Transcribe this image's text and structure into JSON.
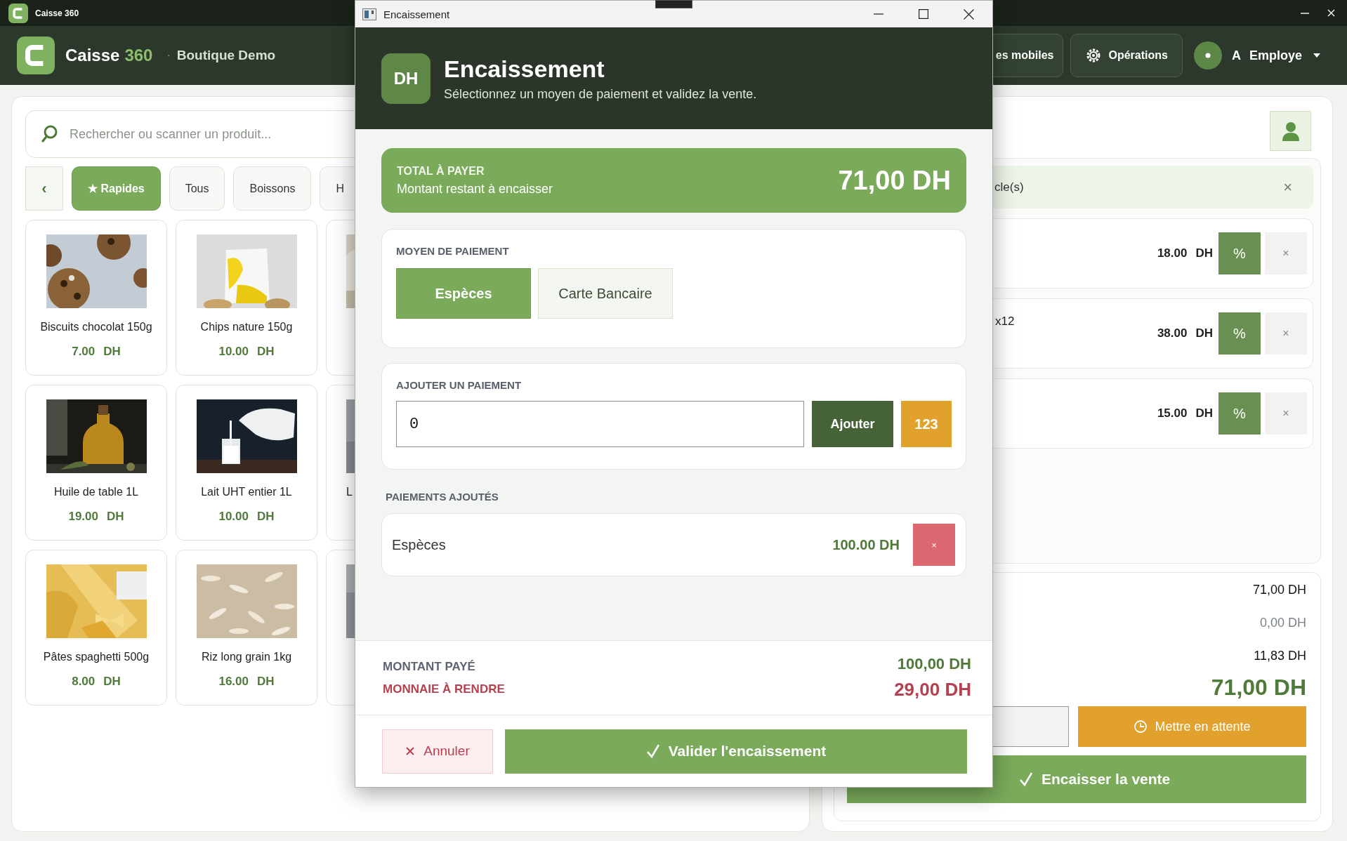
{
  "app_titlebar": {
    "title": "Caisse 360"
  },
  "header": {
    "brand": "Caisse",
    "brand_suffix": "360",
    "separator": "·",
    "shop": "Boutique Demo",
    "buttons": [
      {
        "kind": "plain",
        "label": "es mobiles"
      },
      {
        "kind": "gear",
        "label": "Opérations"
      }
    ],
    "user": {
      "initial": "A",
      "name": "Employe"
    }
  },
  "products": {
    "search": {
      "placeholder": "Rechercher ou scanner un produit..."
    },
    "back": "‹",
    "categories": [
      {
        "label": "★ Rapides",
        "selected": true
      },
      {
        "label": "Tous",
        "selected": false
      },
      {
        "label": "Boissons",
        "selected": false
      },
      {
        "label": "H",
        "selected": false
      }
    ],
    "items": [
      {
        "kind": "product",
        "name": "Biscuits chocolat 150g",
        "price": "7.00",
        "currency": "DH"
      },
      {
        "kind": "product",
        "name": "Chips nature 150g",
        "price": "10.00",
        "currency": "DH"
      },
      {
        "kind": "partial"
      },
      {
        "kind": "product",
        "name": "Huile de table 1L",
        "price": "19.00",
        "currency": "DH"
      },
      {
        "kind": "product",
        "name": "Lait UHT entier 1L",
        "price": "10.00",
        "currency": "DH"
      },
      {
        "kind": "partial",
        "name": "L"
      },
      {
        "kind": "product",
        "name": "Pâtes spaghetti 500g",
        "price": "8.00",
        "currency": "DH"
      },
      {
        "kind": "product",
        "name": "Riz long grain 1kg",
        "price": "16.00",
        "currency": "DH"
      },
      {
        "kind": "partial"
      }
    ]
  },
  "cart": {
    "banner": {
      "text": "cle(s)",
      "close": "×"
    },
    "lines": [
      {
        "price": "18.00",
        "currency": "DH",
        "discount": "%",
        "remove": "×"
      },
      {
        "detail": "x12",
        "price": "38.00",
        "currency": "DH",
        "discount": "%",
        "remove": "×"
      },
      {
        "price": "15.00",
        "currency": "DH",
        "discount": "%",
        "remove": "×"
      }
    ],
    "totals": [
      {
        "value": "71,00 DH",
        "muted": false
      },
      {
        "value": "0,00 DH",
        "muted": true
      },
      {
        "value": "11,83 DH",
        "muted": false
      }
    ],
    "grand_total": "71,00 DH",
    "hold_button": "Mettre en attente",
    "checkout_button": "Encaisser la vente"
  },
  "dialog": {
    "window_title": "Encaissement",
    "badge": "DH",
    "title": "Encaissement",
    "subtitle": "Sélectionnez un moyen de paiement et validez la vente.",
    "total": {
      "label": "TOTAL À PAYER",
      "sublabel": "Montant restant à encaisser",
      "amount": "71,00 DH"
    },
    "method": {
      "label": "MOYEN DE PAIEMENT",
      "options": [
        {
          "label": "Espèces",
          "selected": true
        },
        {
          "label": "Carte Bancaire",
          "selected": false
        }
      ]
    },
    "add": {
      "label": "AJOUTER UN PAIEMENT",
      "value": "0",
      "add_button": "Ajouter",
      "keypad_button": "123"
    },
    "added": {
      "label": "PAIEMENTS AJOUTÉS",
      "payments": [
        {
          "method": "Espèces",
          "amount": "100.00 DH",
          "remove": "×"
        }
      ]
    },
    "summary": {
      "paid_label": "MONTANT PAYÉ",
      "paid": "100,00 DH",
      "change_label": "MONNAIE À RENDRE",
      "change": "29,00 DH"
    },
    "cancel_button": "Annuler",
    "confirm_button": "Valider l'encaissement"
  }
}
